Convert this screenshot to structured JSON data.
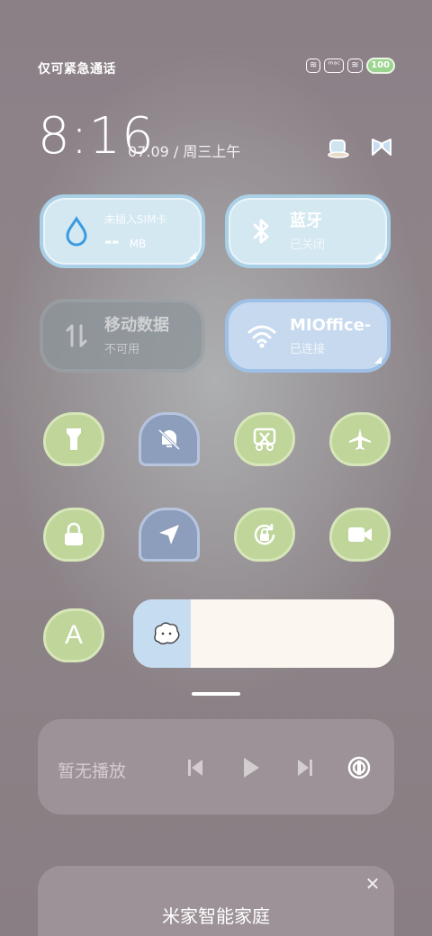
{
  "status_bar": {
    "carrier": "仅可紧急通话",
    "tag_a": "≋",
    "tag_b": "ᵐᵃᶜ",
    "tag_c": "≋",
    "battery": "100"
  },
  "header": {
    "time": "8:16",
    "date": "07.09",
    "separator": "/",
    "weekday": "周三上午"
  },
  "tiles": {
    "data_usage": {
      "title": "未插入SIM卡",
      "value": "--",
      "unit": "MB"
    },
    "bluetooth": {
      "title": "蓝牙",
      "status": "已关闭"
    },
    "mobile_data": {
      "title": "移动数据",
      "status": "不可用"
    },
    "wifi": {
      "title": "MIOffice-",
      "status": "已连接"
    }
  },
  "toggles": [
    {
      "name": "flashlight",
      "icon": "flashlight-icon"
    },
    {
      "name": "mute",
      "icon": "bell-off-icon"
    },
    {
      "name": "screenshot",
      "icon": "scissors-icon"
    },
    {
      "name": "airplane",
      "icon": "airplane-icon"
    },
    {
      "name": "lock",
      "icon": "lock-icon"
    },
    {
      "name": "location",
      "icon": "location-icon"
    },
    {
      "name": "rotation-lock",
      "icon": "rotation-lock-icon"
    },
    {
      "name": "screen-record",
      "icon": "video-icon"
    },
    {
      "name": "auto-brightness",
      "icon": "letter-a-icon",
      "label": "A"
    }
  ],
  "brightness": {
    "level_percent": 22
  },
  "media": {
    "label": "暂无播放"
  },
  "smart_home": {
    "title": "米家智能家庭",
    "close": "✕"
  },
  "colors": {
    "accent_blue": "#a9d0e6",
    "toggle_green": "#bfd59a",
    "house_blue": "#8d9ebd"
  }
}
